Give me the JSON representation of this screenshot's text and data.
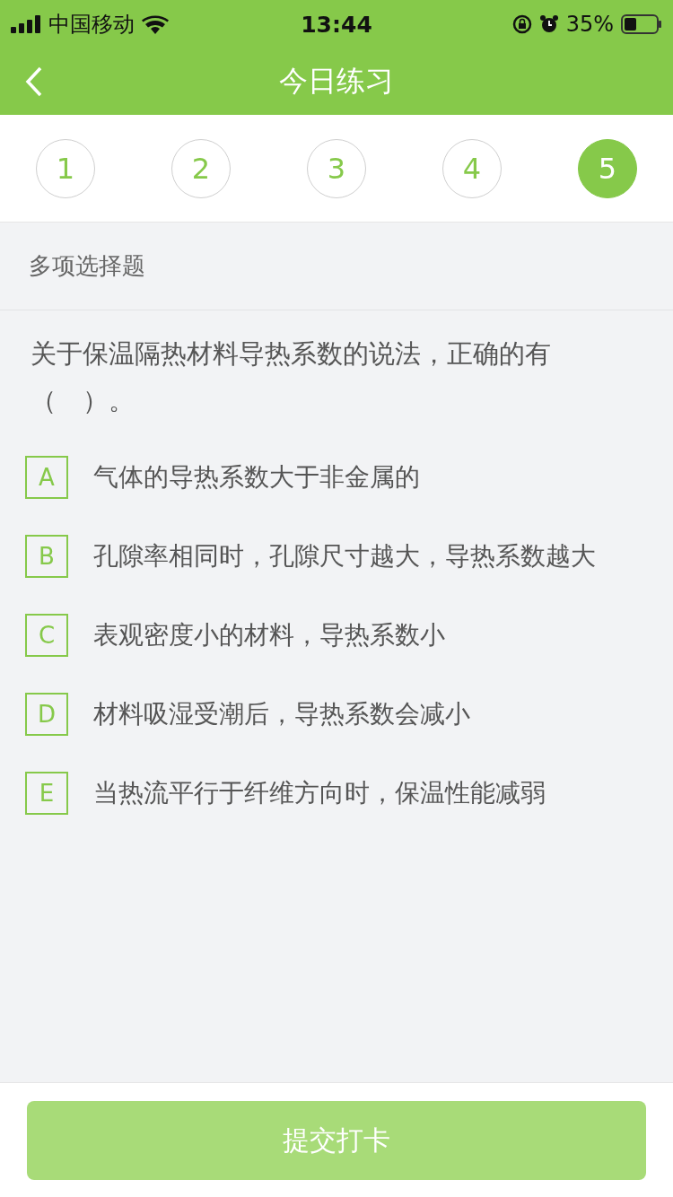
{
  "status_bar": {
    "carrier": "中国移动",
    "time": "13:44",
    "battery": "35%"
  },
  "nav": {
    "title": "今日练习"
  },
  "question_tabs": [
    {
      "label": "1",
      "selected": false
    },
    {
      "label": "2",
      "selected": false
    },
    {
      "label": "3",
      "selected": false
    },
    {
      "label": "4",
      "selected": false
    },
    {
      "label": "5",
      "selected": true
    }
  ],
  "question_type": "多项选择题",
  "question": "关于保温隔热材料导热系数的说法，正确的有（　）。",
  "options": [
    {
      "letter": "A",
      "text": "气体的导热系数大于非金属的",
      "selected": false
    },
    {
      "letter": "B",
      "text": "孔隙率相同时，孔隙尺寸越大，导热系数越大",
      "selected": false
    },
    {
      "letter": "C",
      "text": "表观密度小的材料，导热系数小",
      "selected": false
    },
    {
      "letter": "D",
      "text": "材料吸湿受潮后，导热系数会减小",
      "selected": false
    },
    {
      "letter": "E",
      "text": "当热流平行于纤维方向时，保温性能减弱",
      "selected": false
    }
  ],
  "submit": {
    "label": "提交打卡",
    "disabled": true
  }
}
